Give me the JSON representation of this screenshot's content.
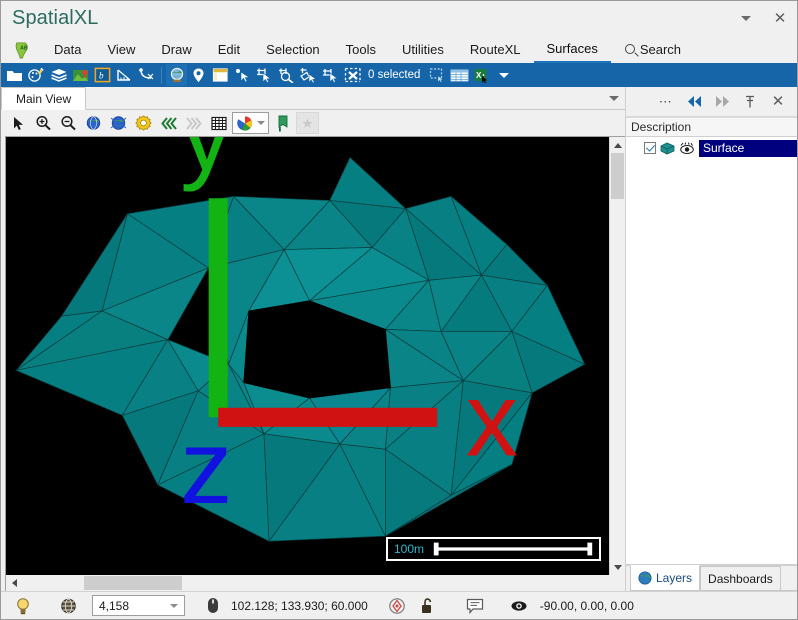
{
  "window": {
    "title": "SpatialXL",
    "controls": [
      {
        "name": "dropdown-chevron",
        "icon": "chevron-down-icon"
      },
      {
        "name": "close",
        "icon": "close-icon",
        "glyph": "✕"
      }
    ]
  },
  "ribbon": {
    "logo_icon": "africa-logo-icon",
    "tabs": [
      {
        "label": "Data",
        "active": false
      },
      {
        "label": "View",
        "active": false
      },
      {
        "label": "Draw",
        "active": false
      },
      {
        "label": "Edit",
        "active": false
      },
      {
        "label": "Selection",
        "active": false
      },
      {
        "label": "Tools",
        "active": false
      },
      {
        "label": "Utilities",
        "active": false
      },
      {
        "label": "RouteXL",
        "active": false
      },
      {
        "label": "Surfaces",
        "active": true
      }
    ],
    "search_label": "Search"
  },
  "toolbar": {
    "selection_status": "0 selected",
    "buttons": [
      {
        "name": "open-folder-icon"
      },
      {
        "name": "palette-pin-icon"
      },
      {
        "name": "layers-stack-icon"
      },
      {
        "name": "map-pin-image-icon"
      },
      {
        "name": "bookmark-b-icon"
      },
      {
        "name": "measure-ruler-icon"
      },
      {
        "name": "node-edit-icon"
      },
      {
        "name": "globe-3d-icon"
      },
      {
        "name": "location-pin-icon"
      },
      {
        "name": "window-snapshot-icon"
      },
      {
        "name": "select-point-icon"
      },
      {
        "name": "select-rectangle-icon"
      },
      {
        "name": "select-circle-icon"
      },
      {
        "name": "select-polygon-icon"
      },
      {
        "name": "select-subtract-icon"
      },
      {
        "name": "clear-selection-icon"
      },
      {
        "name": "selection-add-icon"
      },
      {
        "name": "attribute-table-icon"
      },
      {
        "name": "export-excel-icon"
      },
      {
        "name": "overflow-chevron-icon"
      }
    ]
  },
  "document_tabs": {
    "tabs": [
      {
        "label": "Main View",
        "active": true
      }
    ],
    "overflow_icon": "chevron-down-icon"
  },
  "view_toolbar": {
    "buttons": [
      {
        "name": "pointer-select-icon"
      },
      {
        "name": "zoom-in-icon"
      },
      {
        "name": "zoom-out-icon"
      },
      {
        "name": "zoom-extent-globe-icon"
      },
      {
        "name": "zoom-previous-globe-icon"
      },
      {
        "name": "view-settings-gear-icon"
      },
      {
        "name": "step-back-icon"
      },
      {
        "name": "step-forward-icon"
      },
      {
        "name": "grid-icon"
      },
      {
        "name": "color-palette-icon"
      },
      {
        "name": "bookmark-flag-icon"
      },
      {
        "name": "snapshot-star-icon"
      }
    ]
  },
  "viewport": {
    "background_color": "#000000",
    "surface_color": "#067f82",
    "surface_color_dark": "#046f73",
    "surface_color_light": "#0b8d90",
    "wireframe_color": "#0a2c2e",
    "scale_bar": {
      "label": "100m",
      "label_color": "#2fb6c9"
    },
    "axis_gizmo": {
      "x_label": "x",
      "x_color": "#d11212",
      "y_label": "y",
      "y_color": "#12b312",
      "z_label": "z",
      "z_color": "#1212e0"
    }
  },
  "dock": {
    "header_buttons": [
      {
        "name": "more-options-icon",
        "glyph": "•••"
      },
      {
        "name": "collapse-left-icon",
        "glyph": "◀◀"
      },
      {
        "name": "expand-right-icon",
        "glyph": "▶▶"
      },
      {
        "name": "pin-icon",
        "glyph": "☩"
      },
      {
        "name": "close-panel-icon",
        "glyph": "✕"
      }
    ],
    "column_header": "Description",
    "tree": [
      {
        "label": "Surface",
        "checked": true,
        "selected": true,
        "icons": [
          "surface-layer-icon",
          "visibility-eye-icon"
        ]
      }
    ],
    "tabs": [
      {
        "label": "Layers",
        "icon": "globe-icon",
        "active": true
      },
      {
        "label": "Dashboards",
        "icon": "",
        "active": false
      }
    ]
  },
  "statusbar": {
    "light_icon": "light-bulb-icon",
    "render_icon": "wireframe-globe-icon",
    "element_count": "4,158",
    "mouse_icon": "mouse-icon",
    "coordinates": "102.128; 133.930; 60.000",
    "snap_icon": "snap-target-icon",
    "lock_icon": "unlocked-padlock-icon",
    "note_icon": "annotation-icon",
    "eye_icon": "camera-eye-icon",
    "camera_angles": "-90.00, 0.00, 0.00"
  },
  "colors": {
    "accent_blue": "#1565a8",
    "title_green": "#2c6b5f",
    "tree_select": "#00007f",
    "teal_surface": "#067f82"
  }
}
